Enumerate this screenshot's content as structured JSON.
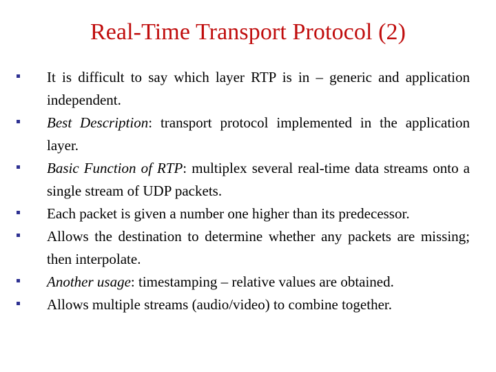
{
  "slide": {
    "title": "Real-Time Transport Protocol (2)",
    "title_color": "#C00D0D",
    "body_color": "#000000",
    "bullet_color": "#2E3192",
    "background_color": "#FFFFFF",
    "bullets": [
      {
        "lead": "",
        "lead_punct": "",
        "text": "It is difficult to say which layer RTP is in – generic and application independent.",
        "multiline": true
      },
      {
        "lead": "Best Description",
        "lead_punct": ":",
        "text": " transport protocol implemented in the application layer.",
        "multiline": true
      },
      {
        "lead": "Basic Function of RTP",
        "lead_punct": ":",
        "text": " multiplex several real-time data streams onto a single stream of UDP packets.",
        "multiline": true
      },
      {
        "lead": "",
        "lead_punct": "",
        "text": "Each packet is given a number one higher than its predecessor.",
        "multiline": true
      },
      {
        "lead": "",
        "lead_punct": "",
        "text": "Allows the destination to determine whether any packets are missing; then interpolate.",
        "multiline": true
      },
      {
        "lead": "Another usage",
        "lead_punct": ":",
        "text": " timestamping – relative values are obtained.",
        "multiline": false
      },
      {
        "lead": "",
        "lead_punct": "",
        "text": "Allows multiple streams (audio/video) to combine together.",
        "multiline": false
      }
    ]
  }
}
